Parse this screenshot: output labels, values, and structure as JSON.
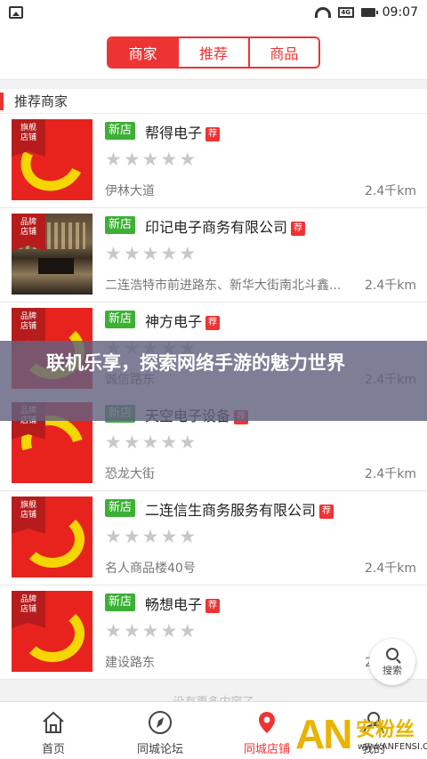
{
  "status_bar": {
    "time": "09:07"
  },
  "segment_tabs": [
    {
      "label": "商家",
      "active": true
    },
    {
      "label": "推荐",
      "active": false
    },
    {
      "label": "商品",
      "active": false
    }
  ],
  "section_title": "推荐商家",
  "shops": [
    {
      "badge": "旗舰\n店铺",
      "tag": "新店",
      "name": "帮得电子",
      "rec": "荐",
      "rating": 0,
      "address": "伊林大道",
      "distance": "2.4千km",
      "thumb": "logo-a"
    },
    {
      "badge": "品牌\n店铺",
      "tag": "新店",
      "name": "印记电子商务有限公司",
      "rec": "荐",
      "rating": 0,
      "address": "二连浩特市前进路东、新华大街南北斗鑫...",
      "distance": "2.4千km",
      "thumb": "photo"
    },
    {
      "badge": "品牌\n店铺",
      "tag": "新店",
      "name": "神方电子",
      "rec": "荐",
      "rating": 0,
      "address": "诚信路东",
      "distance": "2.4千km",
      "thumb": "logo-b"
    },
    {
      "badge": "品牌\n店铺",
      "tag": "新店",
      "name": "天空电子设备",
      "rec": "荐",
      "rating": 0,
      "address": "恐龙大街",
      "distance": "2.4千km",
      "thumb": "logo-c"
    },
    {
      "badge": "旗舰\n店铺",
      "tag": "新店",
      "name": "二连信生商务服务有限公司",
      "rec": "荐",
      "rating": 0,
      "address": "名人商品楼40号",
      "distance": "2.4千km",
      "thumb": "logo-b"
    },
    {
      "badge": "品牌\n店铺",
      "tag": "新店",
      "name": "畅想电子",
      "rec": "荐",
      "rating": 0,
      "address": "建设路东",
      "distance": "2.4千km",
      "thumb": "logo-b"
    }
  ],
  "overlay_title": "联机乐享，探索网络手游的魅力世界",
  "load_more": "没有更多内容了",
  "search_fab": "搜索",
  "tabbar": [
    {
      "label": "首页",
      "icon": "home-icon",
      "active": false
    },
    {
      "label": "同城论坛",
      "icon": "compass-icon",
      "active": false
    },
    {
      "label": "同城店铺",
      "icon": "location-pin-icon",
      "active": true
    },
    {
      "label": "我的",
      "icon": "user-icon",
      "active": false
    }
  ],
  "watermark": {
    "brand": "AN",
    "text": "安粉丝",
    "url": "www.ANFENSI.COM"
  },
  "colors": {
    "accent": "#ee3333",
    "new_tag": "#3cb034",
    "logo_bg": "#e8231e",
    "logo_yellow": "#f5d600"
  }
}
